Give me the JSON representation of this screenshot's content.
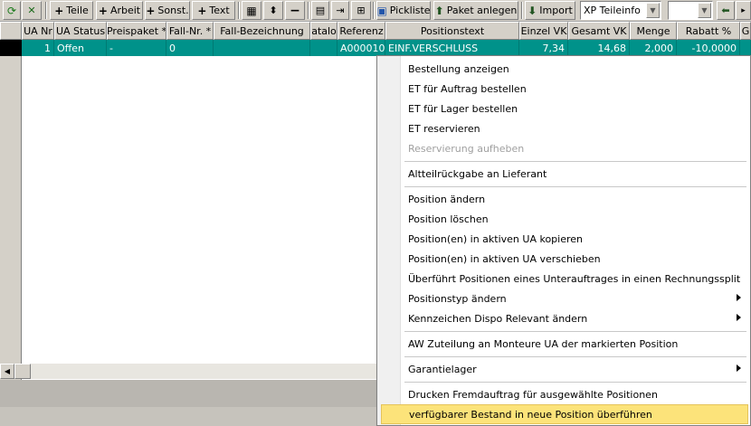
{
  "toolbar": {
    "teile": "Teile",
    "arbeit": "Arbeit",
    "sonst": "Sonst.",
    "text": "Text",
    "pickliste": "Pickliste",
    "paket_anlegen": "Paket anlegen",
    "import": "Import",
    "teileinfo_combo": "XP Teileinfo",
    "combo2_value": ""
  },
  "grid": {
    "columns": [
      "UA Nr",
      "UA Status",
      "Preispaket *",
      "Fall-Nr. *",
      "Fall-Bezeichnung",
      "atalo",
      "Referenz",
      "Positionstext",
      "Einzel VK",
      "Gesamt VK",
      "Menge",
      "Rabatt %",
      "G"
    ],
    "rows": [
      [
        "1",
        "Offen",
        "-",
        "0",
        "",
        "",
        "A000010",
        "EINF.VERSCHLUSS",
        "7,34",
        "14,68",
        "2,000",
        "-10,0000",
        ""
      ]
    ]
  },
  "menu": {
    "items": [
      {
        "label": "Bestellung anzeigen"
      },
      {
        "label": "ET für Auftrag bestellen"
      },
      {
        "label": "ET für Lager bestellen"
      },
      {
        "label": "ET reservieren"
      },
      {
        "label": "Reservierung aufheben",
        "disabled": true
      },
      {
        "label": "Altteilrückgabe an Lieferant"
      },
      {
        "label": "Position ändern"
      },
      {
        "label": "Position löschen"
      },
      {
        "label": "Position(en) in aktiven UA kopieren"
      },
      {
        "label": "Position(en) in aktiven UA verschieben"
      },
      {
        "label": "Überführt Positionen eines Unterauftrages in einen Rechnungssplit"
      },
      {
        "label": "Positionstyp ändern"
      },
      {
        "label": "Kennzeichen Dispo Relevant ändern"
      },
      {
        "label": "AW Zuteilung an Monteure UA der markierten Position"
      },
      {
        "label": "Garantielager"
      },
      {
        "label": "Drucken Fremdauftrag für ausgewählte Positionen"
      },
      {
        "label": "verfügbarer Bestand in neue Position überführen",
        "selected": true
      }
    ]
  },
  "colors": {
    "row_highlight": "#00928a",
    "menu_selected": "#fce37a",
    "chrome": "#d4d0c8"
  }
}
